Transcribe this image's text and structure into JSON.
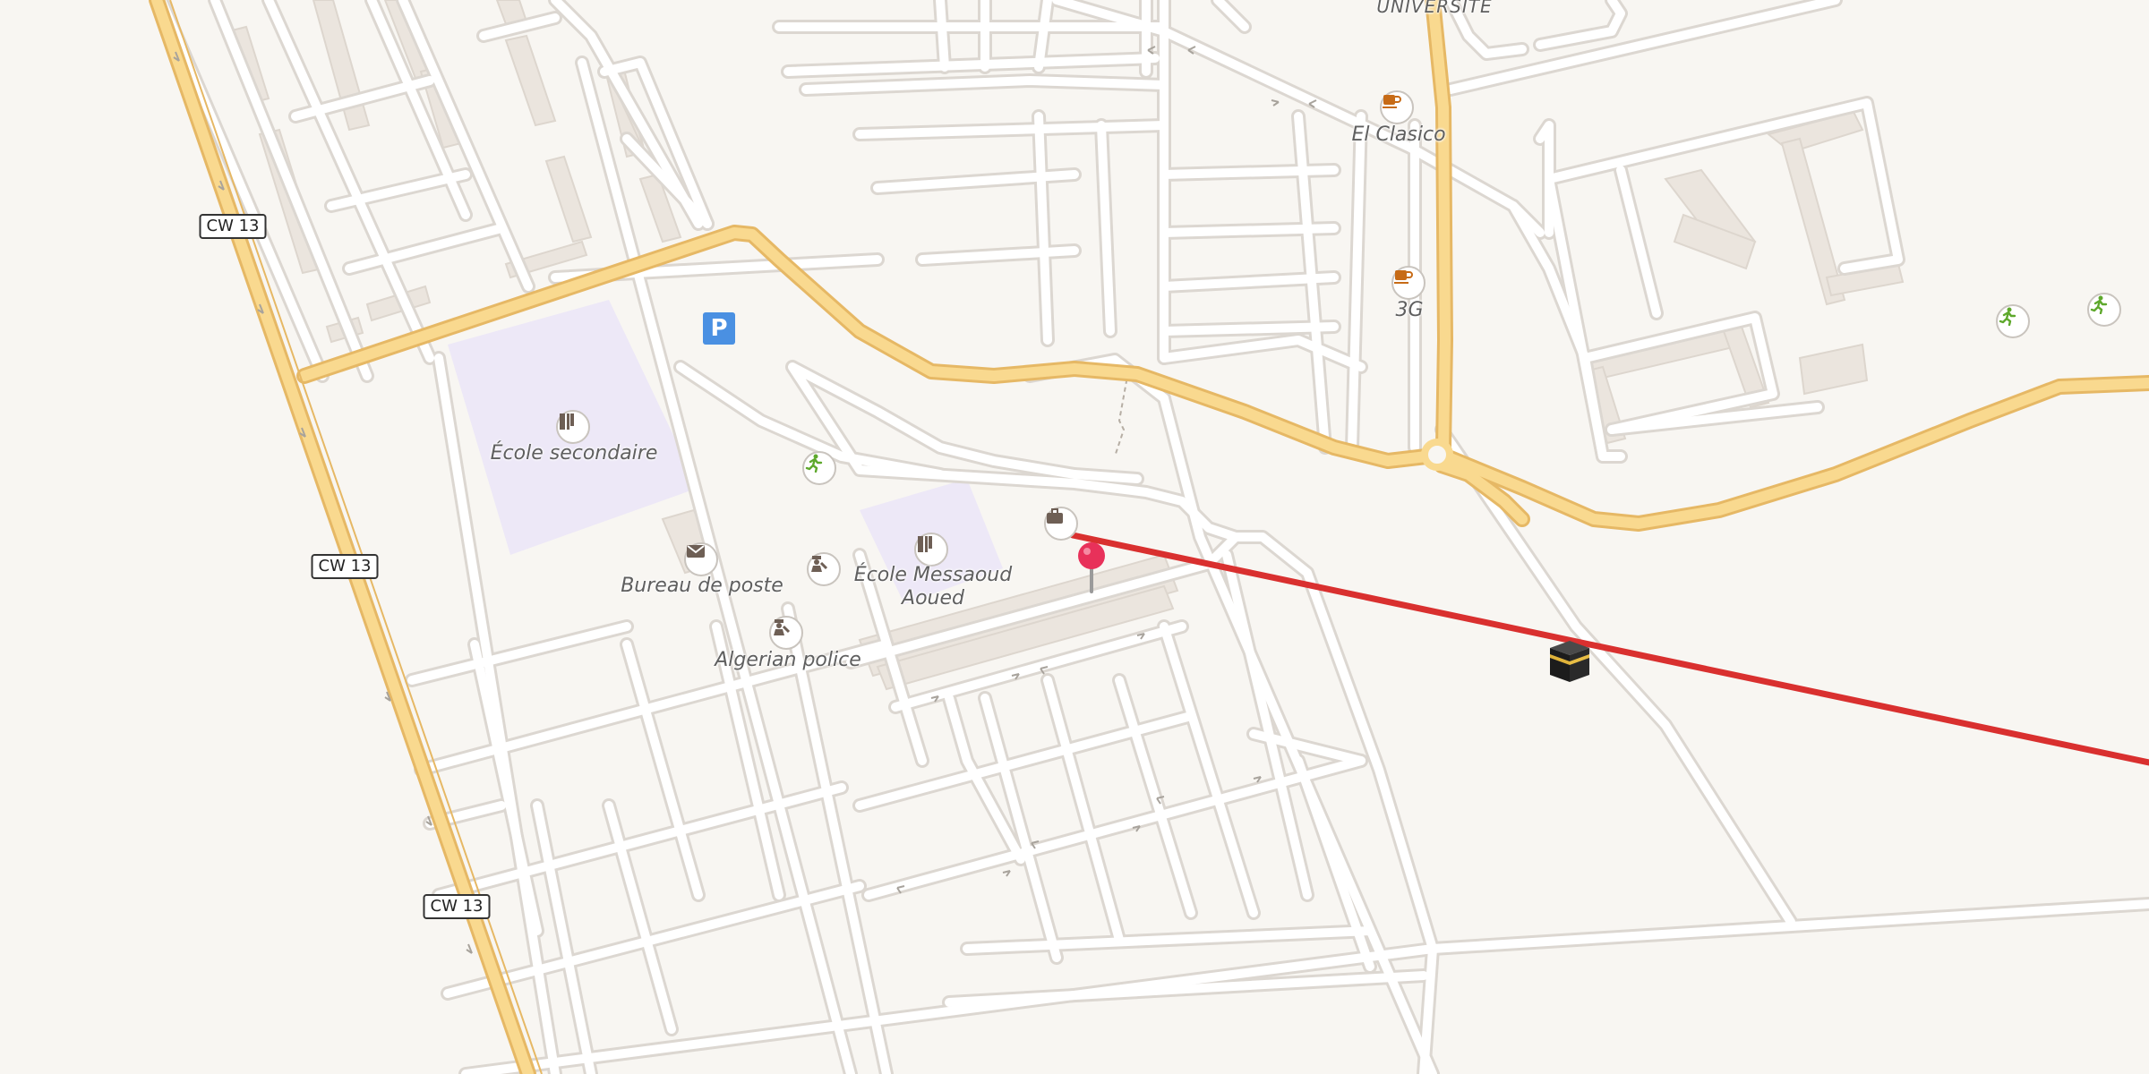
{
  "map": {
    "labels": {
      "universite": "UNIVERSITE",
      "el_clasico": "El Clasico",
      "cafe_3g": "3G",
      "ecole_secondaire": "École secondaire",
      "bureau_de_poste": "Bureau de poste",
      "ecole_messaoud_aoued": "École Messaoud Aoued",
      "algerian_police": "Algerian police"
    },
    "road_shields": [
      "CW 13",
      "CW 13",
      "CW 13"
    ],
    "parking_symbol": "P",
    "icons": {
      "cafe": "coffee-cup-icon",
      "school": "school-icon",
      "post": "envelope-icon",
      "police": "police-icon",
      "sports": "running-person-icon",
      "parking": "parking-icon",
      "place_of_worship": "kaaba-icon",
      "shop": "briefcase-icon",
      "marker": "map-pin-icon"
    },
    "colors": {
      "background": "#f8f6f2",
      "road_casing": "#dcd7d1",
      "road_fill": "#ffffff",
      "primary_road_fill": "#f9d98f",
      "primary_road_casing": "#e6b865",
      "school_area": "#ede8f7",
      "building": "#ebe5de",
      "qibla_line": "#d9302f",
      "marker": "#e8315a",
      "cafe_icon": "#c76b16",
      "sports_icon": "#5ea82c",
      "parking": "#4a90e2"
    }
  }
}
